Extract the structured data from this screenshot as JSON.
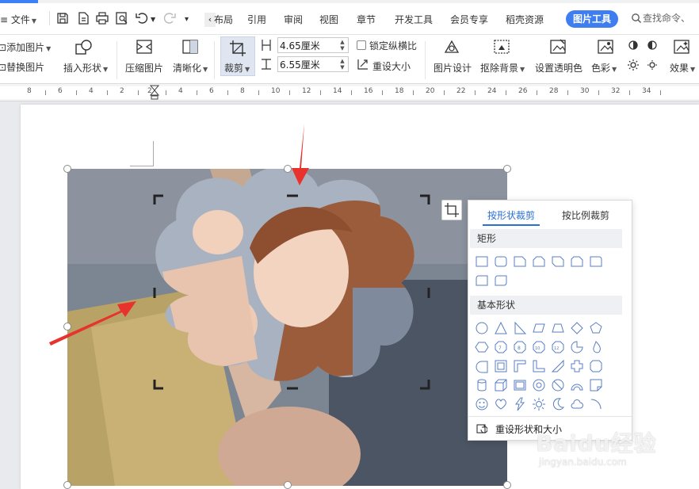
{
  "menu": {
    "file_label": "文件",
    "tabs": [
      "布局",
      "引用",
      "审阅",
      "视图",
      "章节",
      "开发工具",
      "会员专享",
      "稻壳资源"
    ],
    "active_tab": "图片工具",
    "search_placeholder": "查找命令、"
  },
  "ribbon": {
    "add_picture": "添加图片",
    "replace_picture": "替换图片",
    "insert_shape": "插入形状",
    "compress": "压缩图片",
    "sharpen": "清晰化",
    "crop": "裁剪",
    "width_value": "4.65厘米",
    "height_value": "6.55厘米",
    "lock_ratio": "锁定纵横比",
    "reset_size": "重设大小",
    "picture_design": "图片设计",
    "remove_bg": "抠除背景",
    "set_transparent": "设置透明色",
    "color": "色彩",
    "effects": "效果"
  },
  "ruler": {
    "labels": [
      "8",
      "6",
      "4",
      "2",
      "2",
      "4",
      "6",
      "8",
      "10",
      "12",
      "14",
      "16",
      "18",
      "20",
      "22",
      "24",
      "26",
      "28",
      "30",
      "32",
      "34"
    ]
  },
  "crop_panel": {
    "tab_shape": "按形状裁剪",
    "tab_ratio": "按比例裁剪",
    "section_rect": "矩形",
    "section_basic": "基本形状",
    "reset_label": "重设形状和大小"
  },
  "watermark": {
    "brand": "Baidu经验",
    "url": "jingyan.baidu.com"
  },
  "colors": {
    "accent": "#3e7ef0",
    "annotation_arrow": "#e8322e",
    "panel_link": "#2a6fd6"
  }
}
